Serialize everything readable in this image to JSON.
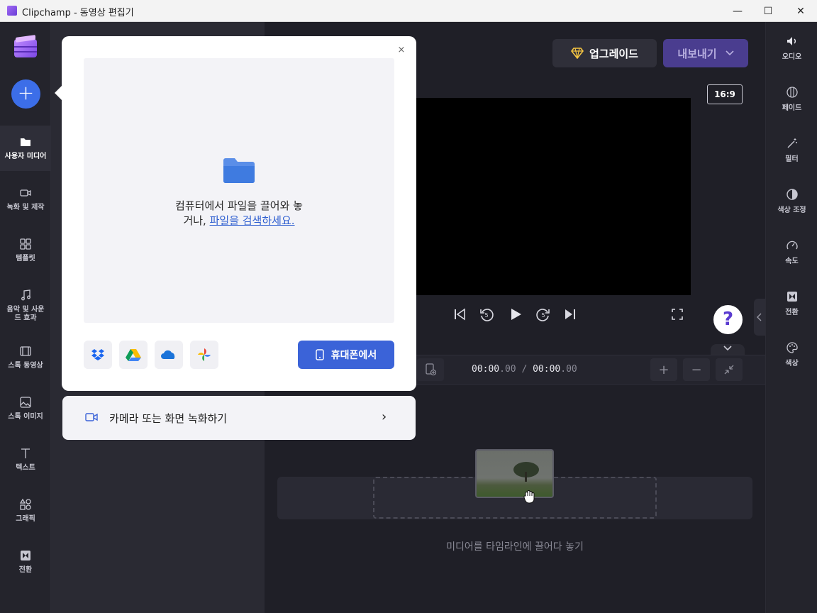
{
  "window": {
    "title": "Clipchamp - 동영상 편집기",
    "minimize_glyph": "—",
    "maximize_glyph": "☐",
    "close_glyph": "✕"
  },
  "left_rail": {
    "add_glyph": "+",
    "items": [
      {
        "label": "사용자 미디어",
        "icon": "folder-icon"
      },
      {
        "label": "녹화 및 제작",
        "icon": "video-camera-icon"
      },
      {
        "label": "템플릿",
        "icon": "template-icon"
      },
      {
        "label": "음악 및 사운드 효과",
        "icon": "music-note-icon"
      },
      {
        "label": "스톡 동영상",
        "icon": "film-icon"
      },
      {
        "label": "스톡 이미지",
        "icon": "image-icon"
      },
      {
        "label": "텍스트",
        "icon": "text-icon"
      },
      {
        "label": "그래픽",
        "icon": "shapes-icon"
      },
      {
        "label": "전환",
        "icon": "transition-icon"
      }
    ]
  },
  "header": {
    "upgrade_label": "업그레이드",
    "export_label": "내보내기",
    "aspect_ratio": "16:9"
  },
  "player": {
    "skip_back_seconds": "5",
    "skip_forward_seconds": "5"
  },
  "timeline": {
    "current_time_main": "00:00",
    "current_time_frac": ".00",
    "separator": "/",
    "total_time_main": "00:00",
    "total_time_frac": ".00",
    "zoom_in_glyph": "+",
    "zoom_out_glyph": "−",
    "drop_hint": "미디어를 타임라인에 끌어다 놓기"
  },
  "right_rail": {
    "items": [
      {
        "label": "오디오",
        "icon": "speaker-icon"
      },
      {
        "label": "페이드",
        "icon": "fade-icon"
      },
      {
        "label": "필터",
        "icon": "magic-wand-icon"
      },
      {
        "label": "색상 조정",
        "icon": "contrast-icon"
      },
      {
        "label": "속도",
        "icon": "speedometer-icon"
      },
      {
        "label": "전환",
        "icon": "transition-icon"
      },
      {
        "label": "색상",
        "icon": "palette-icon"
      }
    ]
  },
  "help": {
    "glyph": "?"
  },
  "popup": {
    "close_glyph": "×",
    "drop_text_line1": "컴퓨터에서 파일을 끌어와 놓",
    "drop_text_line2_prefix": "거나, ",
    "drop_text_link": "파일을 검색하세요.",
    "sources": [
      "dropbox-icon",
      "google-drive-icon",
      "onedrive-icon",
      "google-photos-icon"
    ],
    "phone_button_label": "휴대폰에서",
    "record_label": "카메라 또는 화면 녹화하기",
    "record_chevron": "›"
  },
  "colors": {
    "accent": "#3c6ee8",
    "upgrade_gem": "#f5c542",
    "export_bg": "#4a3d8f"
  }
}
